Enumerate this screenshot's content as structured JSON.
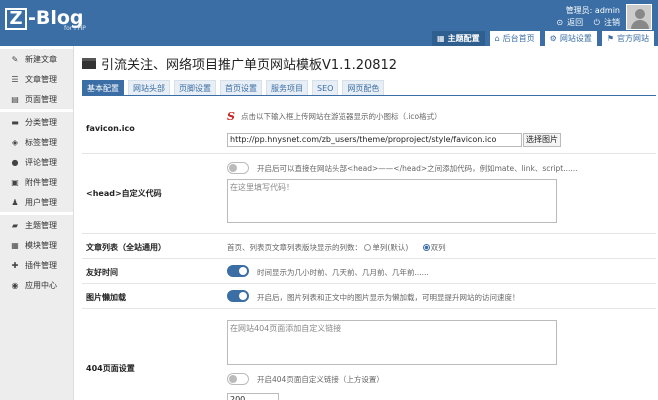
{
  "header": {
    "logo_letter": "Z",
    "logo_text": "-Blog",
    "logo_sub": "for PHP",
    "user_label": "管理员: admin",
    "back_link": "返回",
    "logout_link": "注销",
    "tabs": [
      {
        "label": "主题配置",
        "icon": "grid-icon",
        "active": true
      },
      {
        "label": "后台首页",
        "icon": "home-icon",
        "active": false
      },
      {
        "label": "网站设置",
        "icon": "settings-icon",
        "active": false
      },
      {
        "label": "官方网站",
        "icon": "flag-icon",
        "active": false
      }
    ]
  },
  "sidebar": {
    "items": [
      {
        "label": "新建文章",
        "icon": "edit-icon"
      },
      {
        "label": "文章管理",
        "icon": "list-icon"
      },
      {
        "label": "页面管理",
        "icon": "page-icon"
      },
      {
        "label": "分类管理",
        "icon": "folder-icon"
      },
      {
        "label": "标签管理",
        "icon": "tag-icon"
      },
      {
        "label": "评论管理",
        "icon": "comment-icon"
      },
      {
        "label": "附件管理",
        "icon": "attachment-icon"
      },
      {
        "label": "用户管理",
        "icon": "user-icon"
      },
      {
        "label": "主题管理",
        "icon": "theme-icon"
      },
      {
        "label": "模块管理",
        "icon": "module-icon"
      },
      {
        "label": "插件管理",
        "icon": "plugin-icon"
      },
      {
        "label": "应用中心",
        "icon": "app-center-icon"
      }
    ]
  },
  "main": {
    "title": "引流关注、网络项目推广单页网站模板V1.1.20812",
    "tabs": [
      "基本配置",
      "网站头部",
      "页脚设置",
      "首页设置",
      "服务项目",
      "SEO",
      "网页配色"
    ],
    "fields": {
      "favicon": {
        "label": "favicon.ico",
        "hint": "点击以下输入框上传网站在游览器显示的小图标（.ico格式）",
        "value": "http://pp.hnysnet.com/zb_users/theme/proproject/style/favicon.ico",
        "button": "选择图片"
      },
      "head_code": {
        "label": "<head>自定义代码",
        "hint": "开启后可以直接在网站头部<head>——</head>之间添加代码，例如mate、link、script......",
        "placeholder": "在这里填写代码！"
      },
      "list_mode": {
        "label": "文章列表（全站通用）",
        "hint": "首页、列表页文章列表版块显示的列数：",
        "option_single": "单列(默认)",
        "option_double": "双列"
      },
      "friendly_time": {
        "label": "友好时间",
        "hint": "时间显示为几小时前、几天前、几月前、几年前......"
      },
      "lazy_load": {
        "label": "图片懒加载",
        "hint": "开启后，图片列表和正文中的图片显示为懒加载，可明显提升网站的访问速度！"
      },
      "page404": {
        "label": "404页面设置",
        "placeholder": "在网站404页面添加自定义链接",
        "toggle_hint": "开启404页面自定义链接（上方设置）",
        "delay_value": "200"
      }
    }
  },
  "colors": {
    "header_bg": "#3a6ea5",
    "accent": "#3a6ea5",
    "sidebar_bg": "#ededed"
  }
}
